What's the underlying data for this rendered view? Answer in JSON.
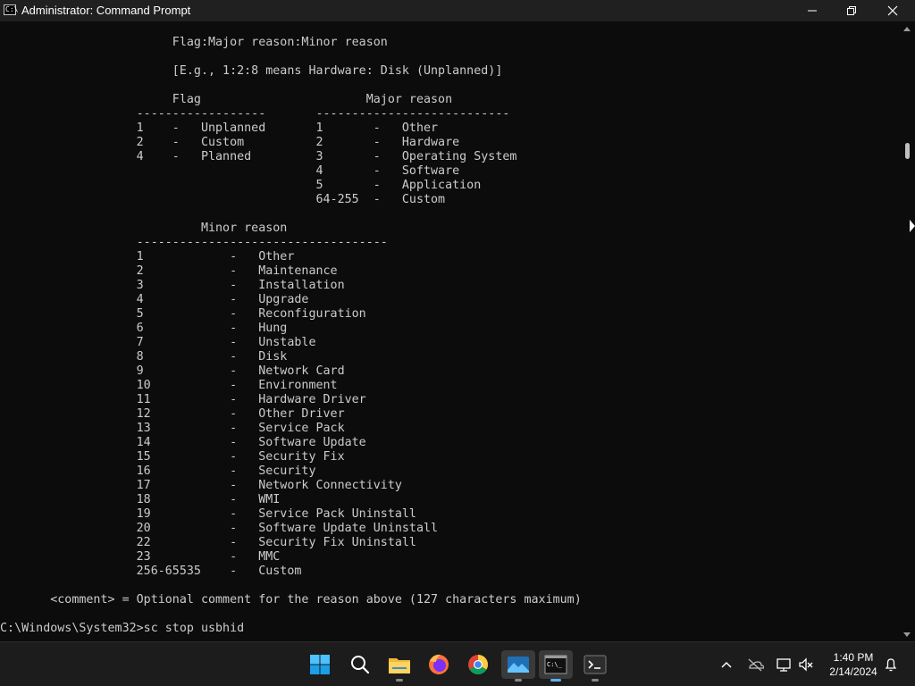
{
  "window": {
    "title": "Administrator: Command Prompt",
    "icon": "cmd-icon"
  },
  "console": {
    "lines": [
      "                        Flag:Major reason:Minor reason",
      "",
      "                        [E.g., 1:2:8 means Hardware: Disk (Unplanned)]",
      "",
      "                        Flag                       Major reason",
      "                   ------------------       ---------------------------",
      "                   1    -   Unplanned       1       -   Other",
      "                   2    -   Custom          2       -   Hardware",
      "                   4    -   Planned         3       -   Operating System",
      "                                            4       -   Software",
      "                                            5       -   Application",
      "                                            64-255  -   Custom",
      "",
      "                            Minor reason",
      "                   -----------------------------------",
      "                   1            -   Other",
      "                   2            -   Maintenance",
      "                   3            -   Installation",
      "                   4            -   Upgrade",
      "                   5            -   Reconfiguration",
      "                   6            -   Hung",
      "                   7            -   Unstable",
      "                   8            -   Disk",
      "                   9            -   Network Card",
      "                   10           -   Environment",
      "                   11           -   Hardware Driver",
      "                   12           -   Other Driver",
      "                   13           -   Service Pack",
      "                   14           -   Software Update",
      "                   15           -   Security Fix",
      "                   16           -   Security",
      "                   17           -   Network Connectivity",
      "                   18           -   WMI",
      "                   19           -   Service Pack Uninstall",
      "                   20           -   Software Update Uninstall",
      "                   22           -   Security Fix Uninstall",
      "                   23           -   MMC",
      "                   256-65535    -   Custom",
      "",
      "       <comment> = Optional comment for the reason above (127 characters maximum)",
      "",
      "C:\\Windows\\System32>sc stop usbhid"
    ]
  },
  "taskbar": {
    "apps": [
      {
        "name": "start-button",
        "icon": "windows-logo-icon"
      },
      {
        "name": "search-button",
        "icon": "search-icon"
      },
      {
        "name": "file-explorer",
        "icon": "folder-icon"
      },
      {
        "name": "firefox",
        "icon": "firefox-icon"
      },
      {
        "name": "chrome",
        "icon": "chrome-icon"
      },
      {
        "name": "photos",
        "icon": "photos-icon"
      },
      {
        "name": "command-prompt",
        "icon": "cmd-icon"
      },
      {
        "name": "terminal",
        "icon": "terminal-icon"
      }
    ],
    "tray_icons": [
      "chevron-up-icon",
      "cloud-offline-icon",
      "network-icon",
      "volume-muted-icon",
      "notification-bell-icon"
    ],
    "time": "1:40 PM",
    "date": "2/14/2024"
  },
  "colors": {
    "console_bg": "#0c0c0c",
    "console_fg": "#cccccc",
    "titlebar_bg": "#202020",
    "taskbar_bg": "#1c1c1c",
    "accent": "#5fb2f2"
  }
}
